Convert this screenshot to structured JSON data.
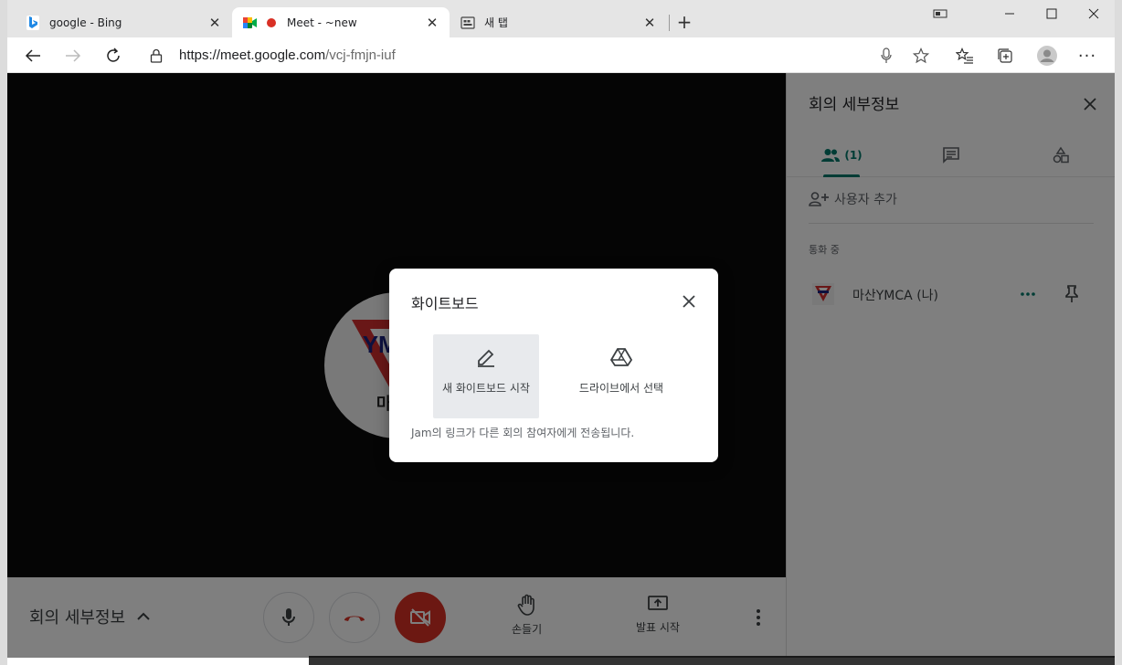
{
  "browser": {
    "tabs": [
      {
        "title": "google - Bing",
        "icon": "bing-icon",
        "active": false
      },
      {
        "title": "Meet - ~new",
        "icon": "meet-icon",
        "active": true,
        "recording": true
      },
      {
        "title": "새 탭",
        "icon": "newtab-page-icon",
        "active": false
      }
    ],
    "url_host": "https://meet.google.com",
    "url_path": "/vcj-fmjn-iuf"
  },
  "meet": {
    "avatar_text": "마산Y",
    "avatar_logo": "YMCA",
    "side_panel": {
      "title": "회의 세부정보",
      "people_count": "(1)",
      "add_person": "사용자 추가",
      "in_call_label": "통화 중",
      "participants": [
        {
          "name": "마산YMCA (나)"
        }
      ]
    },
    "bottom": {
      "details_label": "회의 세부정보",
      "raise_hand": "손들기",
      "present": "발표 시작"
    }
  },
  "dialog": {
    "title": "화이트보드",
    "options": [
      {
        "label": "새 화이트보드 시작",
        "icon": "pen-icon"
      },
      {
        "label": "드라이브에서 선택",
        "icon": "drive-icon"
      }
    ],
    "note": "Jam의 링크가 다른 회의 참여자에게 전송됩니다."
  },
  "colors": {
    "accent": "#00796b",
    "danger": "#d93025",
    "recording": "#d93025"
  }
}
